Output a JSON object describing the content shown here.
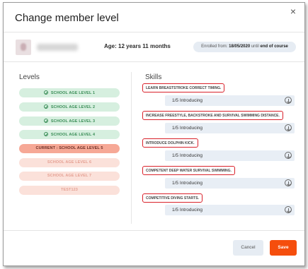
{
  "dialog": {
    "title": "Change member level",
    "close_label": "×"
  },
  "member": {
    "age_label": "Age:",
    "age_value": "12 years 11 months",
    "enrolled_from_label": "Enrolled from:",
    "enrolled_from_date": "18/05/2020",
    "enrolled_until_label": "until",
    "enrolled_until_value": "end of course"
  },
  "levels": {
    "heading": "Levels",
    "items": [
      {
        "label": "SCHOOL AGE LEVEL 1",
        "status": "completed"
      },
      {
        "label": "SCHOOL AGE LEVEL 2",
        "status": "completed"
      },
      {
        "label": "SCHOOL AGE LEVEL 3",
        "status": "completed"
      },
      {
        "label": "SCHOOL AGE LEVEL 4",
        "status": "completed"
      },
      {
        "label": "CURRENT : SCHOOL AGE LEVEL 5",
        "status": "current"
      },
      {
        "label": "SCHOOL AGE LEVEL 6",
        "status": "future"
      },
      {
        "label": "SCHOOL AGE LEVEL 7",
        "status": "future"
      },
      {
        "label": "TEST123",
        "status": "future"
      }
    ]
  },
  "skills": {
    "heading": "Skills",
    "items": [
      {
        "label": "LEARN BREASTSTROKE CORRECT TIMING.",
        "value": "1/5 Introducing"
      },
      {
        "label": "INCREASE FREESTYLE, BACKSTROKE AND SURVIVAL SWIMMING DISTANCE.",
        "value": "1/5 Introducing"
      },
      {
        "label": "INTRODUCE DOLPHIN KICK.",
        "value": "1/5 Introducing"
      },
      {
        "label": "COMPETENT DEEP WATER SURVIVAL SWIMMING.",
        "value": "1/5 Introducing"
      },
      {
        "label": "COMPETITIVE DIVING STARTS.",
        "value": "1/5 Introducing"
      }
    ]
  },
  "footer": {
    "cancel_label": "Cancel",
    "save_label": "Save"
  },
  "colors": {
    "completed_bg": "#d6efdf",
    "current_bg": "#f6a896",
    "future_bg": "#fbe1da",
    "highlight_border": "#d9212a",
    "save_bg": "#f54e0d",
    "select_bg": "#e8eef5"
  },
  "icons": {
    "completed": "check-circle-icon",
    "dropdown": "arrow-down-circle-icon",
    "close": "close-icon"
  }
}
